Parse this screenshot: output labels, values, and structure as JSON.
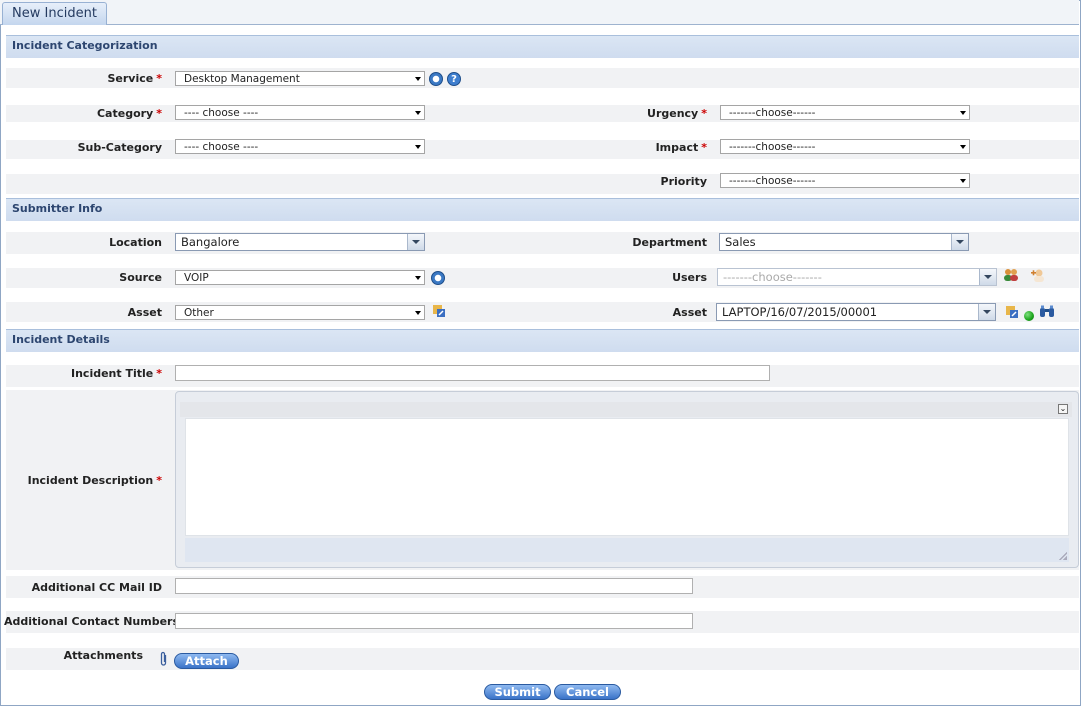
{
  "tab": "New Incident",
  "sections": {
    "categorization": "Incident Categorization",
    "submitter": "Submitter Info",
    "details": "Incident Details"
  },
  "fields": {
    "service": {
      "label": "Service",
      "value": "Desktop Management"
    },
    "category": {
      "label": "Category",
      "value": "---- choose ----"
    },
    "sub_category": {
      "label": "Sub-Category",
      "value": "---- choose ----"
    },
    "urgency": {
      "label": "Urgency",
      "value": "-------choose------"
    },
    "impact": {
      "label": "Impact",
      "value": "-------choose------"
    },
    "priority": {
      "label": "Priority",
      "value": "-------choose------"
    },
    "location": {
      "label": "Location",
      "value": "Bangalore"
    },
    "department": {
      "label": "Department",
      "value": "Sales"
    },
    "source": {
      "label": "Source",
      "value": "VOIP"
    },
    "users": {
      "label": "Users",
      "value": "-------choose-------"
    },
    "asset_left": {
      "label": "Asset",
      "value": "Other"
    },
    "asset_right": {
      "label": "Asset",
      "value": "LAPTOP/16/07/2015/00001"
    },
    "incident_title": {
      "label": "Incident Title",
      "value": ""
    },
    "incident_description": {
      "label": "Incident Description",
      "value": ""
    },
    "cc_mail": {
      "label": "Additional CC Mail ID",
      "value": ""
    },
    "contact_numbers": {
      "label": "Additional Contact Numbers",
      "value": ""
    },
    "attachments": {
      "label": "Attachments"
    }
  },
  "required_mark": "*",
  "buttons": {
    "attach": "Attach",
    "submit": "Submit",
    "cancel": "Cancel"
  },
  "icons": {
    "service_config": "gear-icon",
    "service_help": "help-icon",
    "source_config": "gear-icon",
    "users_lookup": "users-icon",
    "users_add": "add-user-icon",
    "asset_left_edit": "asset-edit-icon",
    "asset_right_edit": "asset-edit-icon",
    "asset_status": "status-dot-icon",
    "asset_search": "binoculars-icon",
    "attachment": "paperclip-icon"
  },
  "colors": {
    "accent": "#3a73c8",
    "section_header_text": "#2d4670",
    "required": "#cc0000",
    "status_dot": "#1aa31a"
  }
}
